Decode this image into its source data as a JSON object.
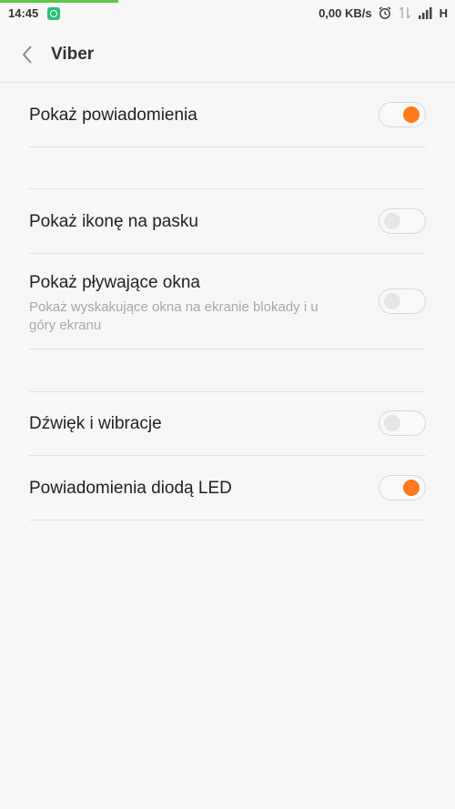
{
  "status_bar": {
    "time": "14:45",
    "net_speed": "0,00 KB/s",
    "network_type": "H",
    "icons": [
      "app-notification-icon",
      "alarm-icon",
      "data-arrows-icon",
      "signal-icon"
    ],
    "progress": 0.26
  },
  "header": {
    "title": "Viber"
  },
  "settings": [
    {
      "label": "Pokaż powiadomienia",
      "enabled": true
    },
    {
      "label": "Pokaż ikonę na pasku",
      "enabled": false
    },
    {
      "label": "Pokaż pływające okna",
      "sublabel": "Pokaż wyskakujące okna na ekranie blokady i u góry ekranu",
      "enabled": false
    },
    {
      "label": "Dźwięk i wibracje",
      "enabled": false
    },
    {
      "label": "Powiadomienia diodą LED",
      "enabled": true
    }
  ],
  "colors": {
    "accent": "#ff7a1a",
    "progress": "#5fc94a",
    "background": "#f7f7f7"
  }
}
